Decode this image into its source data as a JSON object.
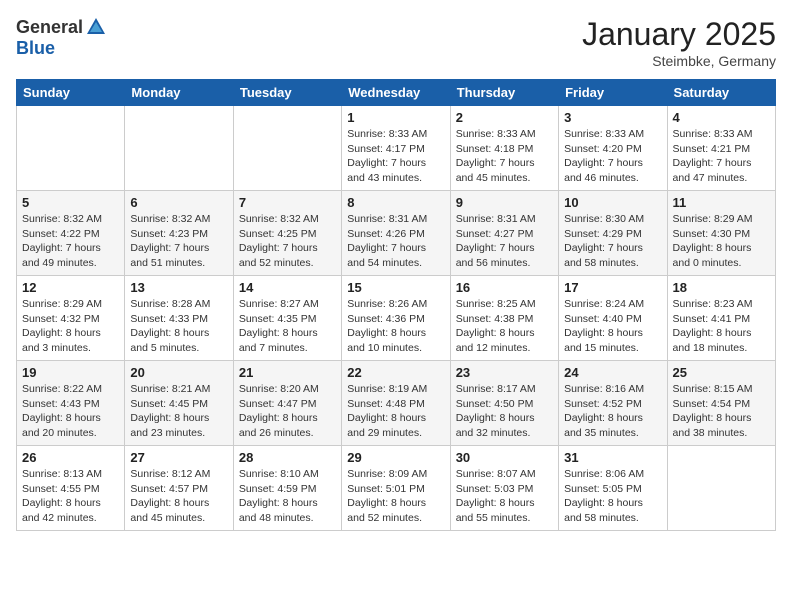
{
  "header": {
    "logo_general": "General",
    "logo_blue": "Blue",
    "month_title": "January 2025",
    "location": "Steimbke, Germany"
  },
  "days_of_week": [
    "Sunday",
    "Monday",
    "Tuesday",
    "Wednesday",
    "Thursday",
    "Friday",
    "Saturday"
  ],
  "weeks": [
    [
      {
        "day": "",
        "sunrise": "",
        "sunset": "",
        "daylight": ""
      },
      {
        "day": "",
        "sunrise": "",
        "sunset": "",
        "daylight": ""
      },
      {
        "day": "",
        "sunrise": "",
        "sunset": "",
        "daylight": ""
      },
      {
        "day": "1",
        "sunrise": "Sunrise: 8:33 AM",
        "sunset": "Sunset: 4:17 PM",
        "daylight": "Daylight: 7 hours and 43 minutes."
      },
      {
        "day": "2",
        "sunrise": "Sunrise: 8:33 AM",
        "sunset": "Sunset: 4:18 PM",
        "daylight": "Daylight: 7 hours and 45 minutes."
      },
      {
        "day": "3",
        "sunrise": "Sunrise: 8:33 AM",
        "sunset": "Sunset: 4:20 PM",
        "daylight": "Daylight: 7 hours and 46 minutes."
      },
      {
        "day": "4",
        "sunrise": "Sunrise: 8:33 AM",
        "sunset": "Sunset: 4:21 PM",
        "daylight": "Daylight: 7 hours and 47 minutes."
      }
    ],
    [
      {
        "day": "5",
        "sunrise": "Sunrise: 8:32 AM",
        "sunset": "Sunset: 4:22 PM",
        "daylight": "Daylight: 7 hours and 49 minutes."
      },
      {
        "day": "6",
        "sunrise": "Sunrise: 8:32 AM",
        "sunset": "Sunset: 4:23 PM",
        "daylight": "Daylight: 7 hours and 51 minutes."
      },
      {
        "day": "7",
        "sunrise": "Sunrise: 8:32 AM",
        "sunset": "Sunset: 4:25 PM",
        "daylight": "Daylight: 7 hours and 52 minutes."
      },
      {
        "day": "8",
        "sunrise": "Sunrise: 8:31 AM",
        "sunset": "Sunset: 4:26 PM",
        "daylight": "Daylight: 7 hours and 54 minutes."
      },
      {
        "day": "9",
        "sunrise": "Sunrise: 8:31 AM",
        "sunset": "Sunset: 4:27 PM",
        "daylight": "Daylight: 7 hours and 56 minutes."
      },
      {
        "day": "10",
        "sunrise": "Sunrise: 8:30 AM",
        "sunset": "Sunset: 4:29 PM",
        "daylight": "Daylight: 7 hours and 58 minutes."
      },
      {
        "day": "11",
        "sunrise": "Sunrise: 8:29 AM",
        "sunset": "Sunset: 4:30 PM",
        "daylight": "Daylight: 8 hours and 0 minutes."
      }
    ],
    [
      {
        "day": "12",
        "sunrise": "Sunrise: 8:29 AM",
        "sunset": "Sunset: 4:32 PM",
        "daylight": "Daylight: 8 hours and 3 minutes."
      },
      {
        "day": "13",
        "sunrise": "Sunrise: 8:28 AM",
        "sunset": "Sunset: 4:33 PM",
        "daylight": "Daylight: 8 hours and 5 minutes."
      },
      {
        "day": "14",
        "sunrise": "Sunrise: 8:27 AM",
        "sunset": "Sunset: 4:35 PM",
        "daylight": "Daylight: 8 hours and 7 minutes."
      },
      {
        "day": "15",
        "sunrise": "Sunrise: 8:26 AM",
        "sunset": "Sunset: 4:36 PM",
        "daylight": "Daylight: 8 hours and 10 minutes."
      },
      {
        "day": "16",
        "sunrise": "Sunrise: 8:25 AM",
        "sunset": "Sunset: 4:38 PM",
        "daylight": "Daylight: 8 hours and 12 minutes."
      },
      {
        "day": "17",
        "sunrise": "Sunrise: 8:24 AM",
        "sunset": "Sunset: 4:40 PM",
        "daylight": "Daylight: 8 hours and 15 minutes."
      },
      {
        "day": "18",
        "sunrise": "Sunrise: 8:23 AM",
        "sunset": "Sunset: 4:41 PM",
        "daylight": "Daylight: 8 hours and 18 minutes."
      }
    ],
    [
      {
        "day": "19",
        "sunrise": "Sunrise: 8:22 AM",
        "sunset": "Sunset: 4:43 PM",
        "daylight": "Daylight: 8 hours and 20 minutes."
      },
      {
        "day": "20",
        "sunrise": "Sunrise: 8:21 AM",
        "sunset": "Sunset: 4:45 PM",
        "daylight": "Daylight: 8 hours and 23 minutes."
      },
      {
        "day": "21",
        "sunrise": "Sunrise: 8:20 AM",
        "sunset": "Sunset: 4:47 PM",
        "daylight": "Daylight: 8 hours and 26 minutes."
      },
      {
        "day": "22",
        "sunrise": "Sunrise: 8:19 AM",
        "sunset": "Sunset: 4:48 PM",
        "daylight": "Daylight: 8 hours and 29 minutes."
      },
      {
        "day": "23",
        "sunrise": "Sunrise: 8:17 AM",
        "sunset": "Sunset: 4:50 PM",
        "daylight": "Daylight: 8 hours and 32 minutes."
      },
      {
        "day": "24",
        "sunrise": "Sunrise: 8:16 AM",
        "sunset": "Sunset: 4:52 PM",
        "daylight": "Daylight: 8 hours and 35 minutes."
      },
      {
        "day": "25",
        "sunrise": "Sunrise: 8:15 AM",
        "sunset": "Sunset: 4:54 PM",
        "daylight": "Daylight: 8 hours and 38 minutes."
      }
    ],
    [
      {
        "day": "26",
        "sunrise": "Sunrise: 8:13 AM",
        "sunset": "Sunset: 4:55 PM",
        "daylight": "Daylight: 8 hours and 42 minutes."
      },
      {
        "day": "27",
        "sunrise": "Sunrise: 8:12 AM",
        "sunset": "Sunset: 4:57 PM",
        "daylight": "Daylight: 8 hours and 45 minutes."
      },
      {
        "day": "28",
        "sunrise": "Sunrise: 8:10 AM",
        "sunset": "Sunset: 4:59 PM",
        "daylight": "Daylight: 8 hours and 48 minutes."
      },
      {
        "day": "29",
        "sunrise": "Sunrise: 8:09 AM",
        "sunset": "Sunset: 5:01 PM",
        "daylight": "Daylight: 8 hours and 52 minutes."
      },
      {
        "day": "30",
        "sunrise": "Sunrise: 8:07 AM",
        "sunset": "Sunset: 5:03 PM",
        "daylight": "Daylight: 8 hours and 55 minutes."
      },
      {
        "day": "31",
        "sunrise": "Sunrise: 8:06 AM",
        "sunset": "Sunset: 5:05 PM",
        "daylight": "Daylight: 8 hours and 58 minutes."
      },
      {
        "day": "",
        "sunrise": "",
        "sunset": "",
        "daylight": ""
      }
    ]
  ]
}
